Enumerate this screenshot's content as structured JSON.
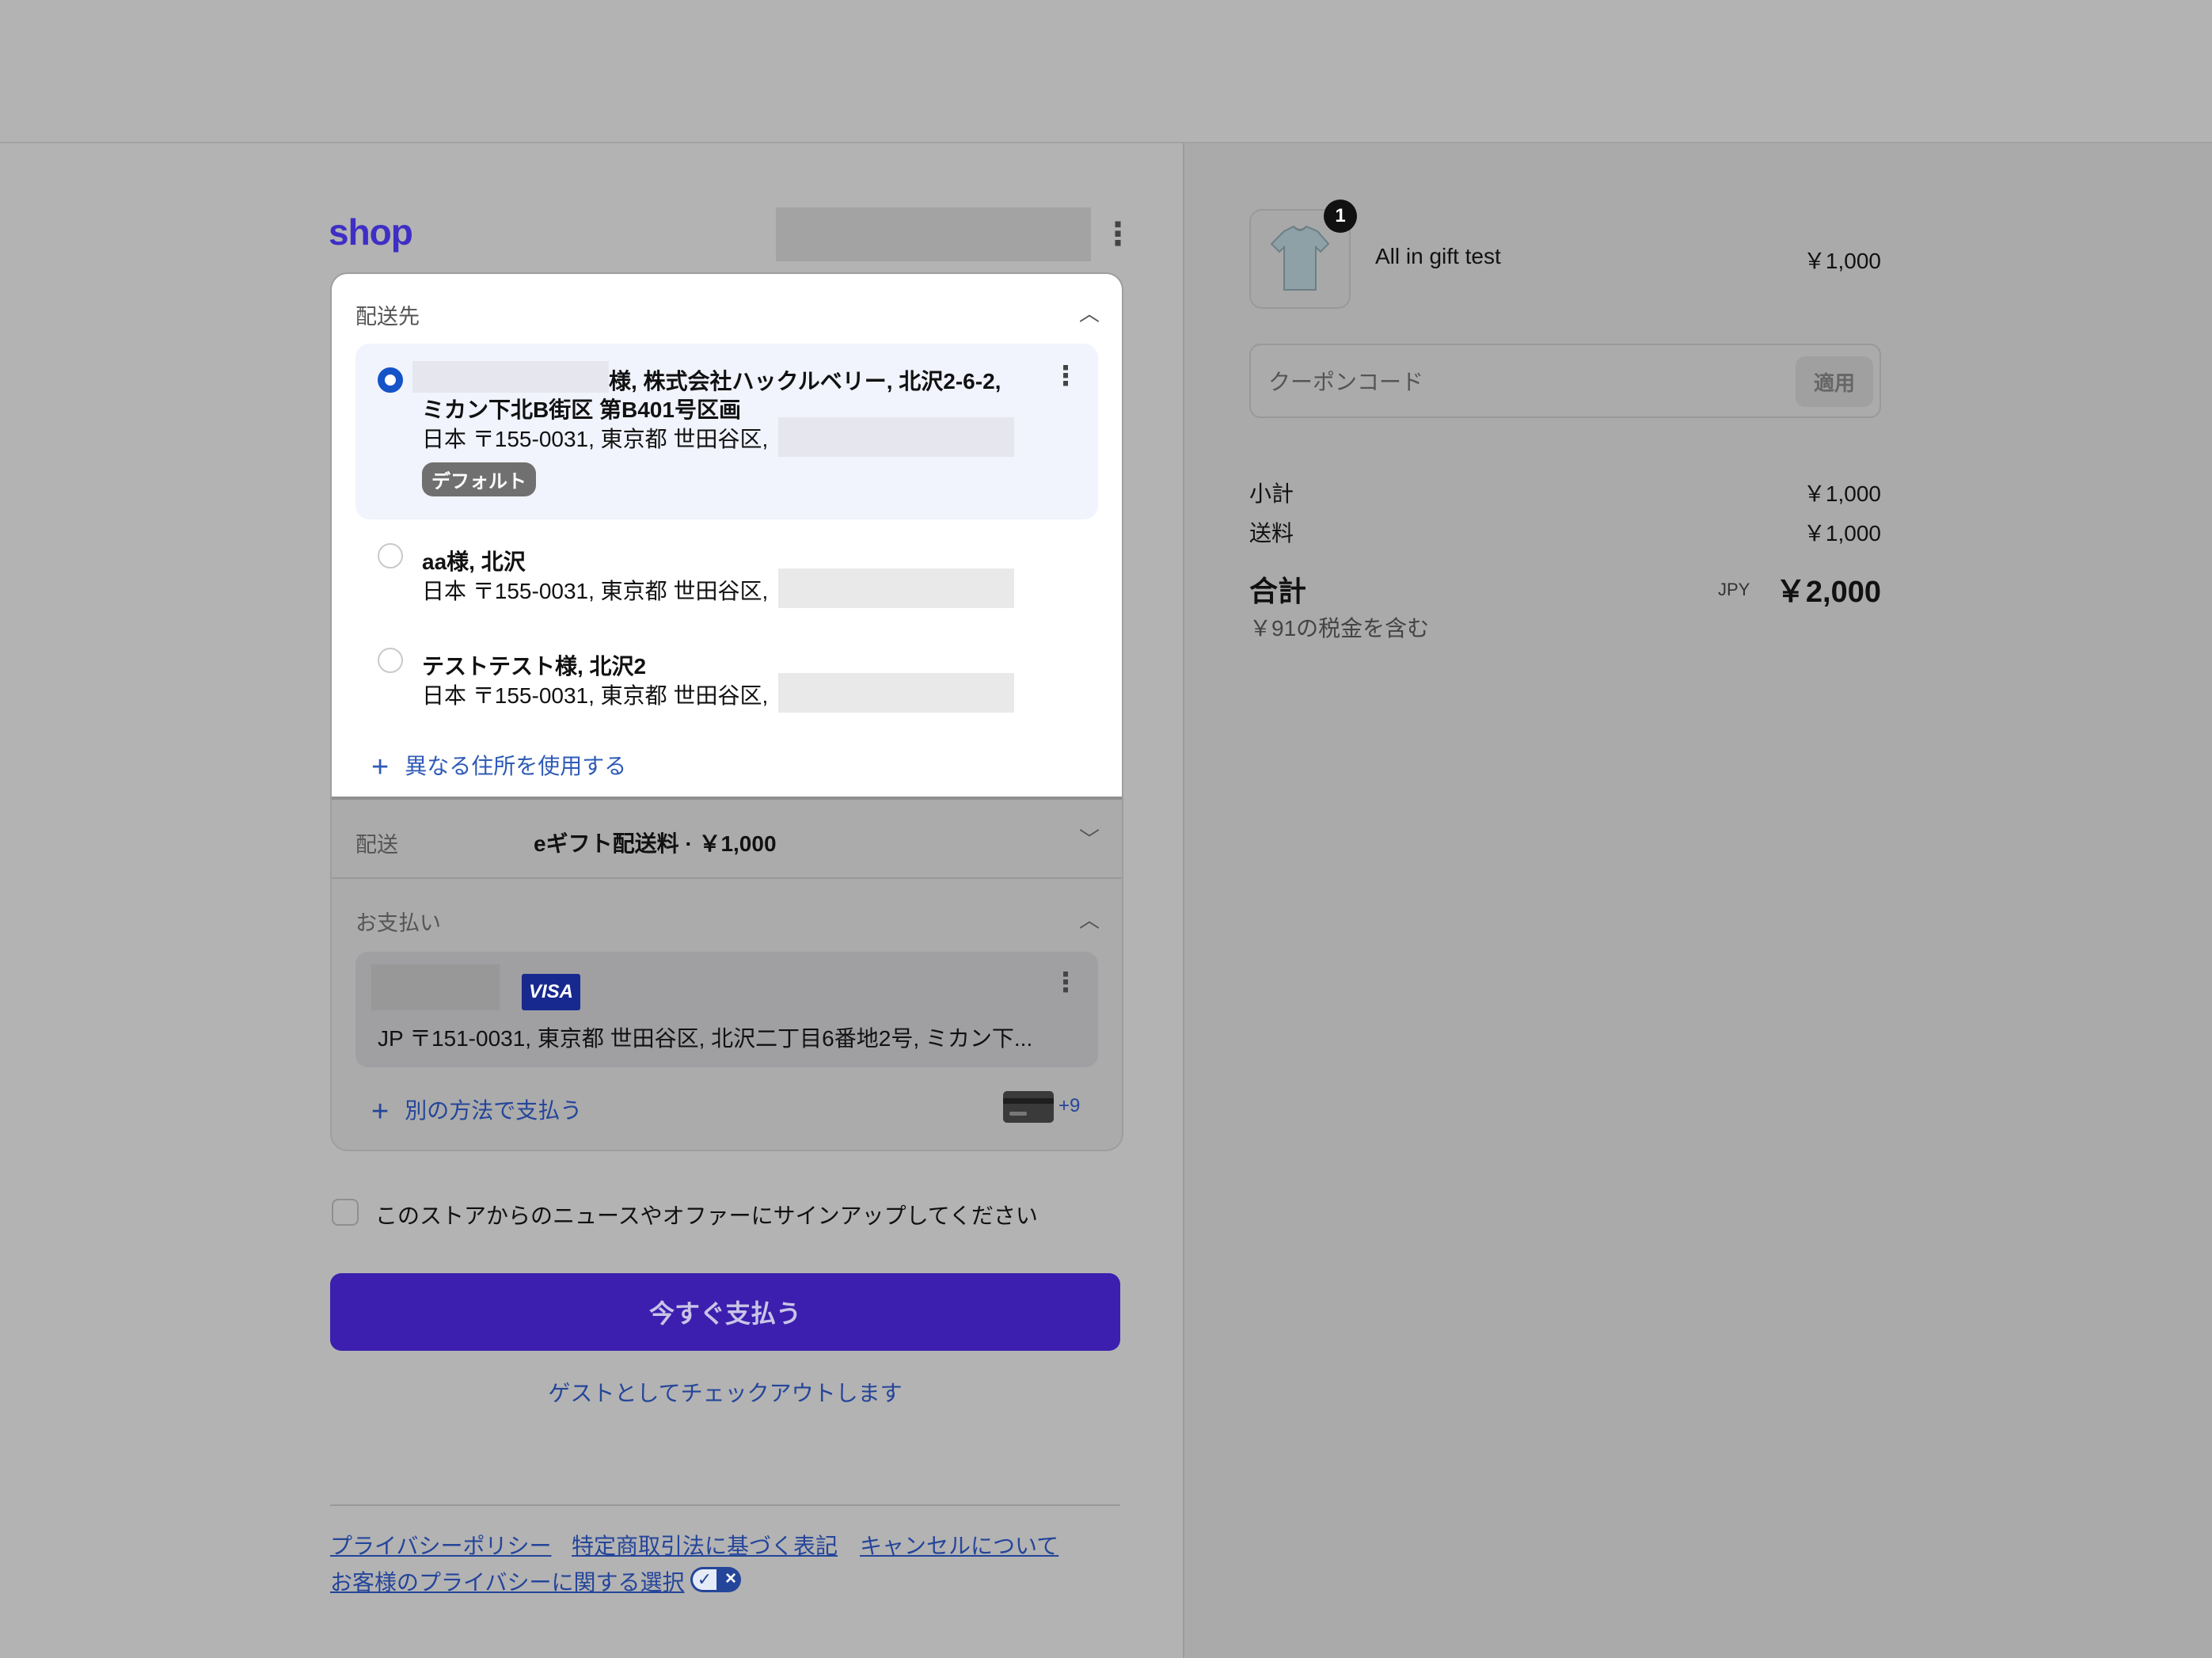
{
  "header": {
    "logo": "shop"
  },
  "shipping_address": {
    "section_label": "配送先",
    "addresses": [
      {
        "line1_suffix": "様, 株式会社ハックルベリー, 北沢2-6-2,",
        "line2": "ミカン下北B街区 第B401号区画",
        "line3": "日本 〒155-0031, 東京都 世田谷区,",
        "badge": "デフォルト",
        "selected": true
      },
      {
        "line1": "aa様, 北沢",
        "line2": "日本 〒155-0031, 東京都 世田谷区,",
        "selected": false
      },
      {
        "line1": "テストテスト様, 北沢2",
        "line2": "日本 〒155-0031, 東京都 世田谷区,",
        "selected": false
      }
    ],
    "add_new_label": "異なる住所を使用する"
  },
  "delivery": {
    "section_label": "配送",
    "value": "eギフト配送料 · ￥1,000"
  },
  "payment": {
    "section_label": "お支払い",
    "card_brand": "VISA",
    "billing_address": "JP 〒151-0031, 東京都 世田谷区, 北沢二丁目6番地2号, ミカン下...",
    "alt_method_label": "別の方法で支払う",
    "more_methods": "+9"
  },
  "newsletter": {
    "label": "このストアからのニュースやオファーにサインアップしてください",
    "checked": false
  },
  "actions": {
    "pay_now": "今すぐ支払う",
    "guest_checkout": "ゲストとしてチェックアウトします"
  },
  "footer": {
    "links": [
      "プライバシーポリシー",
      "特定商取引法に基づく表記",
      "キャンセルについて"
    ],
    "privacy_choices": "お客様のプライバシーに関する選択"
  },
  "order_summary": {
    "product": {
      "name": "All in gift test",
      "price": "￥1,000",
      "quantity": "1"
    },
    "coupon": {
      "placeholder": "クーポンコード",
      "apply_label": "適用"
    },
    "subtotal_label": "小計",
    "subtotal_value": "￥1,000",
    "shipping_label": "送料",
    "shipping_value": "￥1,000",
    "total_label": "合計",
    "currency": "JPY",
    "total_value": "￥2,000",
    "tax_note": "￥91の税金を含む"
  },
  "colors": {
    "brand_purple": "#3f2ec5",
    "pay_button": "#3c1fae",
    "link_blue": "#24459a",
    "radio_selected": "#1553c8"
  }
}
